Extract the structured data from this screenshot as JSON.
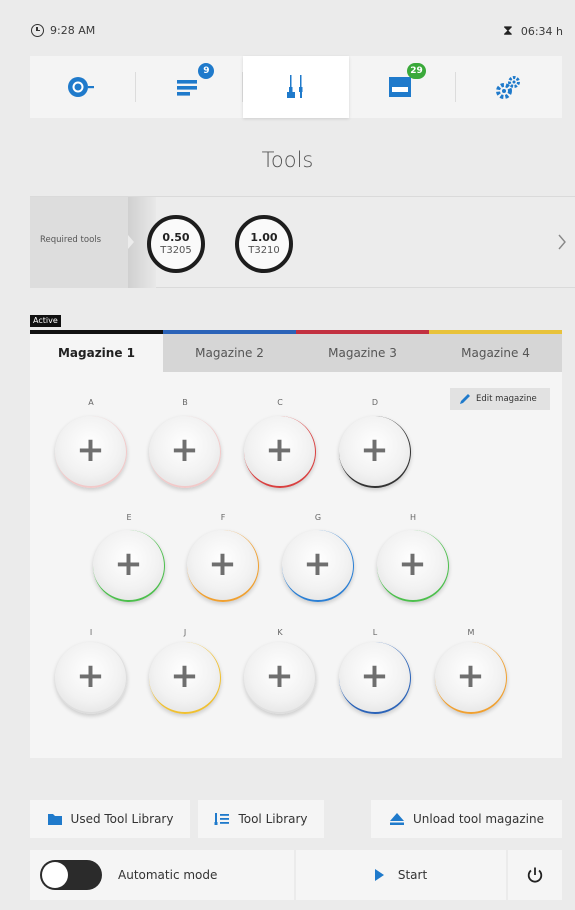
{
  "status": {
    "time": "9:28 AM",
    "duration": "06:34 h"
  },
  "nav": {
    "items": [
      {
        "name": "nav-home",
        "icon": "target-arrow-icon",
        "badge": ""
      },
      {
        "name": "nav-jobs",
        "icon": "list-info-icon",
        "badge": "9"
      },
      {
        "name": "nav-tools",
        "icon": "tools-icon",
        "badge": ""
      },
      {
        "name": "nav-machine",
        "icon": "machine-icon",
        "badge": "29"
      },
      {
        "name": "nav-settings",
        "icon": "gears-icon",
        "badge": ""
      }
    ],
    "active_index": 2,
    "colors": {
      "accent": "#1f7acb",
      "jobs_badge": "#1f7acb",
      "machine_badge": "#3aa93a"
    }
  },
  "title": "Tools",
  "required_tools": {
    "label": "Required tools",
    "tools": [
      {
        "value": "0.50",
        "id": "T3205"
      },
      {
        "value": "1.00",
        "id": "T3210"
      }
    ]
  },
  "magazines": {
    "active_label": "Active",
    "tabs": [
      {
        "label": "Magazine 1",
        "color": "#111111"
      },
      {
        "label": "Magazine 2",
        "color": "#2b63b8"
      },
      {
        "label": "Magazine 3",
        "color": "#c23040"
      },
      {
        "label": "Magazine 4",
        "color": "#e8c23a"
      }
    ],
    "active_index": 0,
    "edit_label": "Edit magazine",
    "slots": [
      {
        "label": "A",
        "ring": "#f1c9c9"
      },
      {
        "label": "B",
        "ring": "#f1c9c9"
      },
      {
        "label": "C",
        "ring": "#d94040"
      },
      {
        "label": "D",
        "ring": "#333333"
      },
      {
        "label": "E",
        "ring": "#4cbf4c"
      },
      {
        "label": "F",
        "ring": "#f0a030"
      },
      {
        "label": "G",
        "ring": "#2b7fd4"
      },
      {
        "label": "H",
        "ring": "#4cbf4c"
      },
      {
        "label": "I",
        "ring": "#dddddd"
      },
      {
        "label": "J",
        "ring": "#f0c030"
      },
      {
        "label": "K",
        "ring": "#dddddd"
      },
      {
        "label": "L",
        "ring": "#2b63b8"
      },
      {
        "label": "M",
        "ring": "#f0a030"
      }
    ]
  },
  "actions": {
    "used_tool_library": "Used Tool Library",
    "tool_library": "Tool Library",
    "unload": "Unload tool magazine",
    "automatic_mode": "Automatic mode",
    "start": "Start"
  }
}
